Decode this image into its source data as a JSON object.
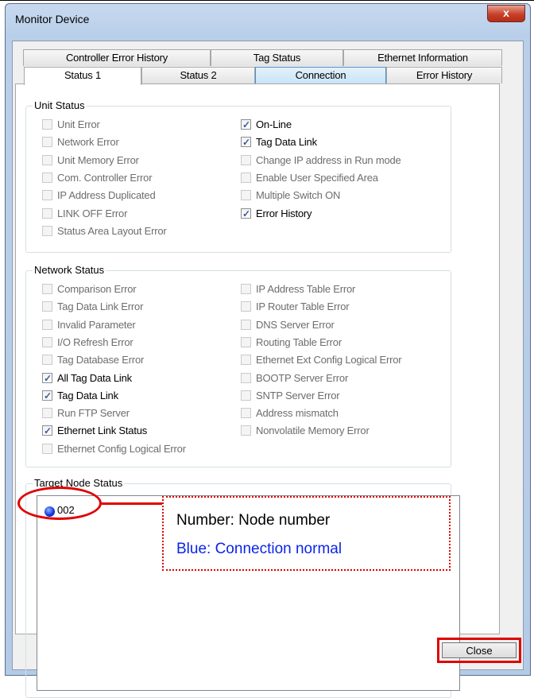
{
  "window": {
    "title": "Monitor Device",
    "close_glyph": "x"
  },
  "tabs": {
    "row1": [
      "Controller Error History",
      "Tag Status",
      "Ethernet Information"
    ],
    "row2": [
      "Status 1",
      "Status 2",
      "Connection",
      "Error History"
    ]
  },
  "unit_status": {
    "title": "Unit Status",
    "left": [
      {
        "label": "Unit Error",
        "checked": false
      },
      {
        "label": "Network Error",
        "checked": false
      },
      {
        "label": "Unit Memory Error",
        "checked": false
      },
      {
        "label": "Com. Controller Error",
        "checked": false
      },
      {
        "label": "IP Address Duplicated",
        "checked": false
      },
      {
        "label": "LINK OFF Error",
        "checked": false
      },
      {
        "label": "Status Area Layout Error",
        "checked": false
      }
    ],
    "right": [
      {
        "label": "On-Line",
        "checked": true
      },
      {
        "label": "Tag Data Link",
        "checked": true
      },
      {
        "label": "Change IP address in Run mode",
        "checked": false
      },
      {
        "label": "Enable User Specified Area",
        "checked": false
      },
      {
        "label": "Multiple Switch ON",
        "checked": false
      },
      {
        "label": "Error History",
        "checked": true
      }
    ]
  },
  "network_status": {
    "title": "Network Status",
    "left": [
      {
        "label": "Comparison Error",
        "checked": false
      },
      {
        "label": "Tag Data Link Error",
        "checked": false
      },
      {
        "label": "Invalid Parameter",
        "checked": false
      },
      {
        "label": "I/O Refresh Error",
        "checked": false
      },
      {
        "label": "Tag Database Error",
        "checked": false
      },
      {
        "label": "All Tag Data Link",
        "checked": true
      },
      {
        "label": "Tag Data Link",
        "checked": true
      },
      {
        "label": "Run FTP Server",
        "checked": false
      },
      {
        "label": "Ethernet Link Status",
        "checked": true
      },
      {
        "label": "Ethernet Config Logical Error",
        "checked": false
      }
    ],
    "right": [
      {
        "label": "IP Address Table Error",
        "checked": false
      },
      {
        "label": "IP Router Table Error",
        "checked": false
      },
      {
        "label": "DNS Server Error",
        "checked": false
      },
      {
        "label": "Routing Table Error",
        "checked": false
      },
      {
        "label": "Ethernet Ext Config Logical Error",
        "checked": false
      },
      {
        "label": "BOOTP Server Error",
        "checked": false
      },
      {
        "label": "SNTP Server Error",
        "checked": false
      },
      {
        "label": "Address mismatch",
        "checked": false
      },
      {
        "label": "Nonvolatile Memory Error",
        "checked": false
      }
    ]
  },
  "target_node_status": {
    "title": "Target Node Status",
    "nodes": [
      {
        "label": "002",
        "color": "#0a2fe0"
      }
    ]
  },
  "callout": {
    "line1": "Number: Node number",
    "line2": "Blue: Connection normal"
  },
  "buttons": {
    "close": "Close"
  }
}
